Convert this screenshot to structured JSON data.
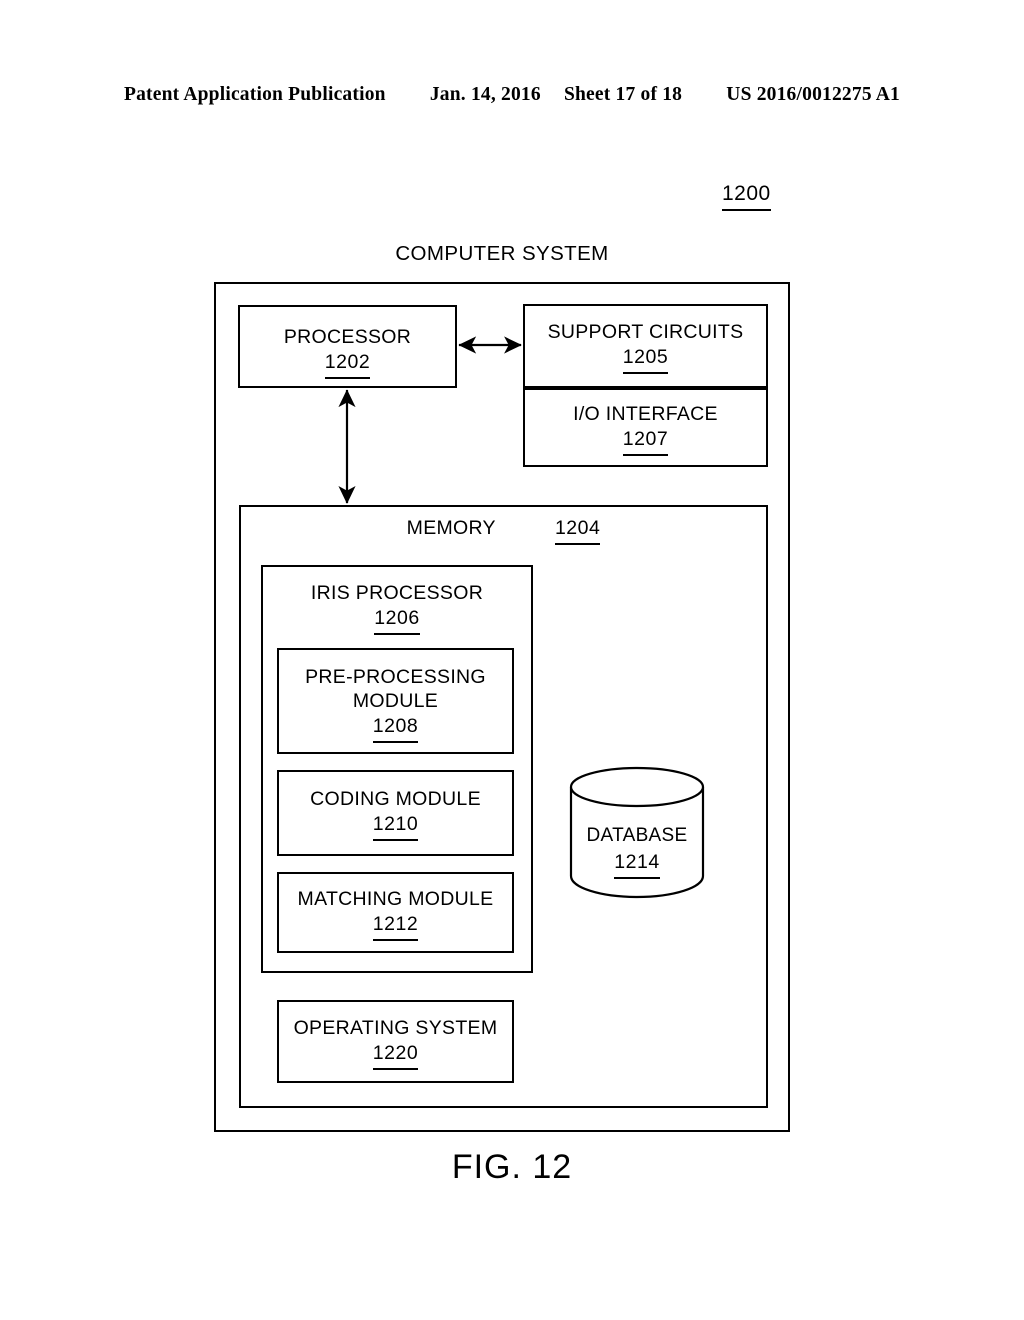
{
  "header": {
    "publication": "Patent Application Publication",
    "date": "Jan. 14, 2016",
    "sheet": "Sheet 17 of 18",
    "patent_number": "US 2016/0012275 A1"
  },
  "figure": {
    "system_ref": "1200",
    "caption": "FIG. 12"
  },
  "diagram": {
    "title": "COMPUTER SYSTEM",
    "processor": {
      "label": "PROCESSOR",
      "ref": "1202"
    },
    "support_circuits": {
      "label": "SUPPORT CIRCUITS",
      "ref": "1205"
    },
    "io_interface": {
      "label": "I/O INTERFACE",
      "ref": "1207"
    },
    "memory": {
      "label": "MEMORY",
      "ref": "1204"
    },
    "iris_processor": {
      "label": "IRIS PROCESSOR",
      "ref": "1206"
    },
    "preprocessing_module": {
      "label_line1": "PRE-PROCESSING",
      "label_line2": "MODULE",
      "ref": "1208"
    },
    "coding_module": {
      "label": "CODING MODULE",
      "ref": "1210"
    },
    "matching_module": {
      "label": "MATCHING MODULE",
      "ref": "1212"
    },
    "database": {
      "label": "DATABASE",
      "ref": "1214"
    },
    "operating_system": {
      "label": "OPERATING SYSTEM",
      "ref": "1220"
    }
  },
  "colors": {
    "ink": "#000000",
    "paper": "#ffffff"
  }
}
